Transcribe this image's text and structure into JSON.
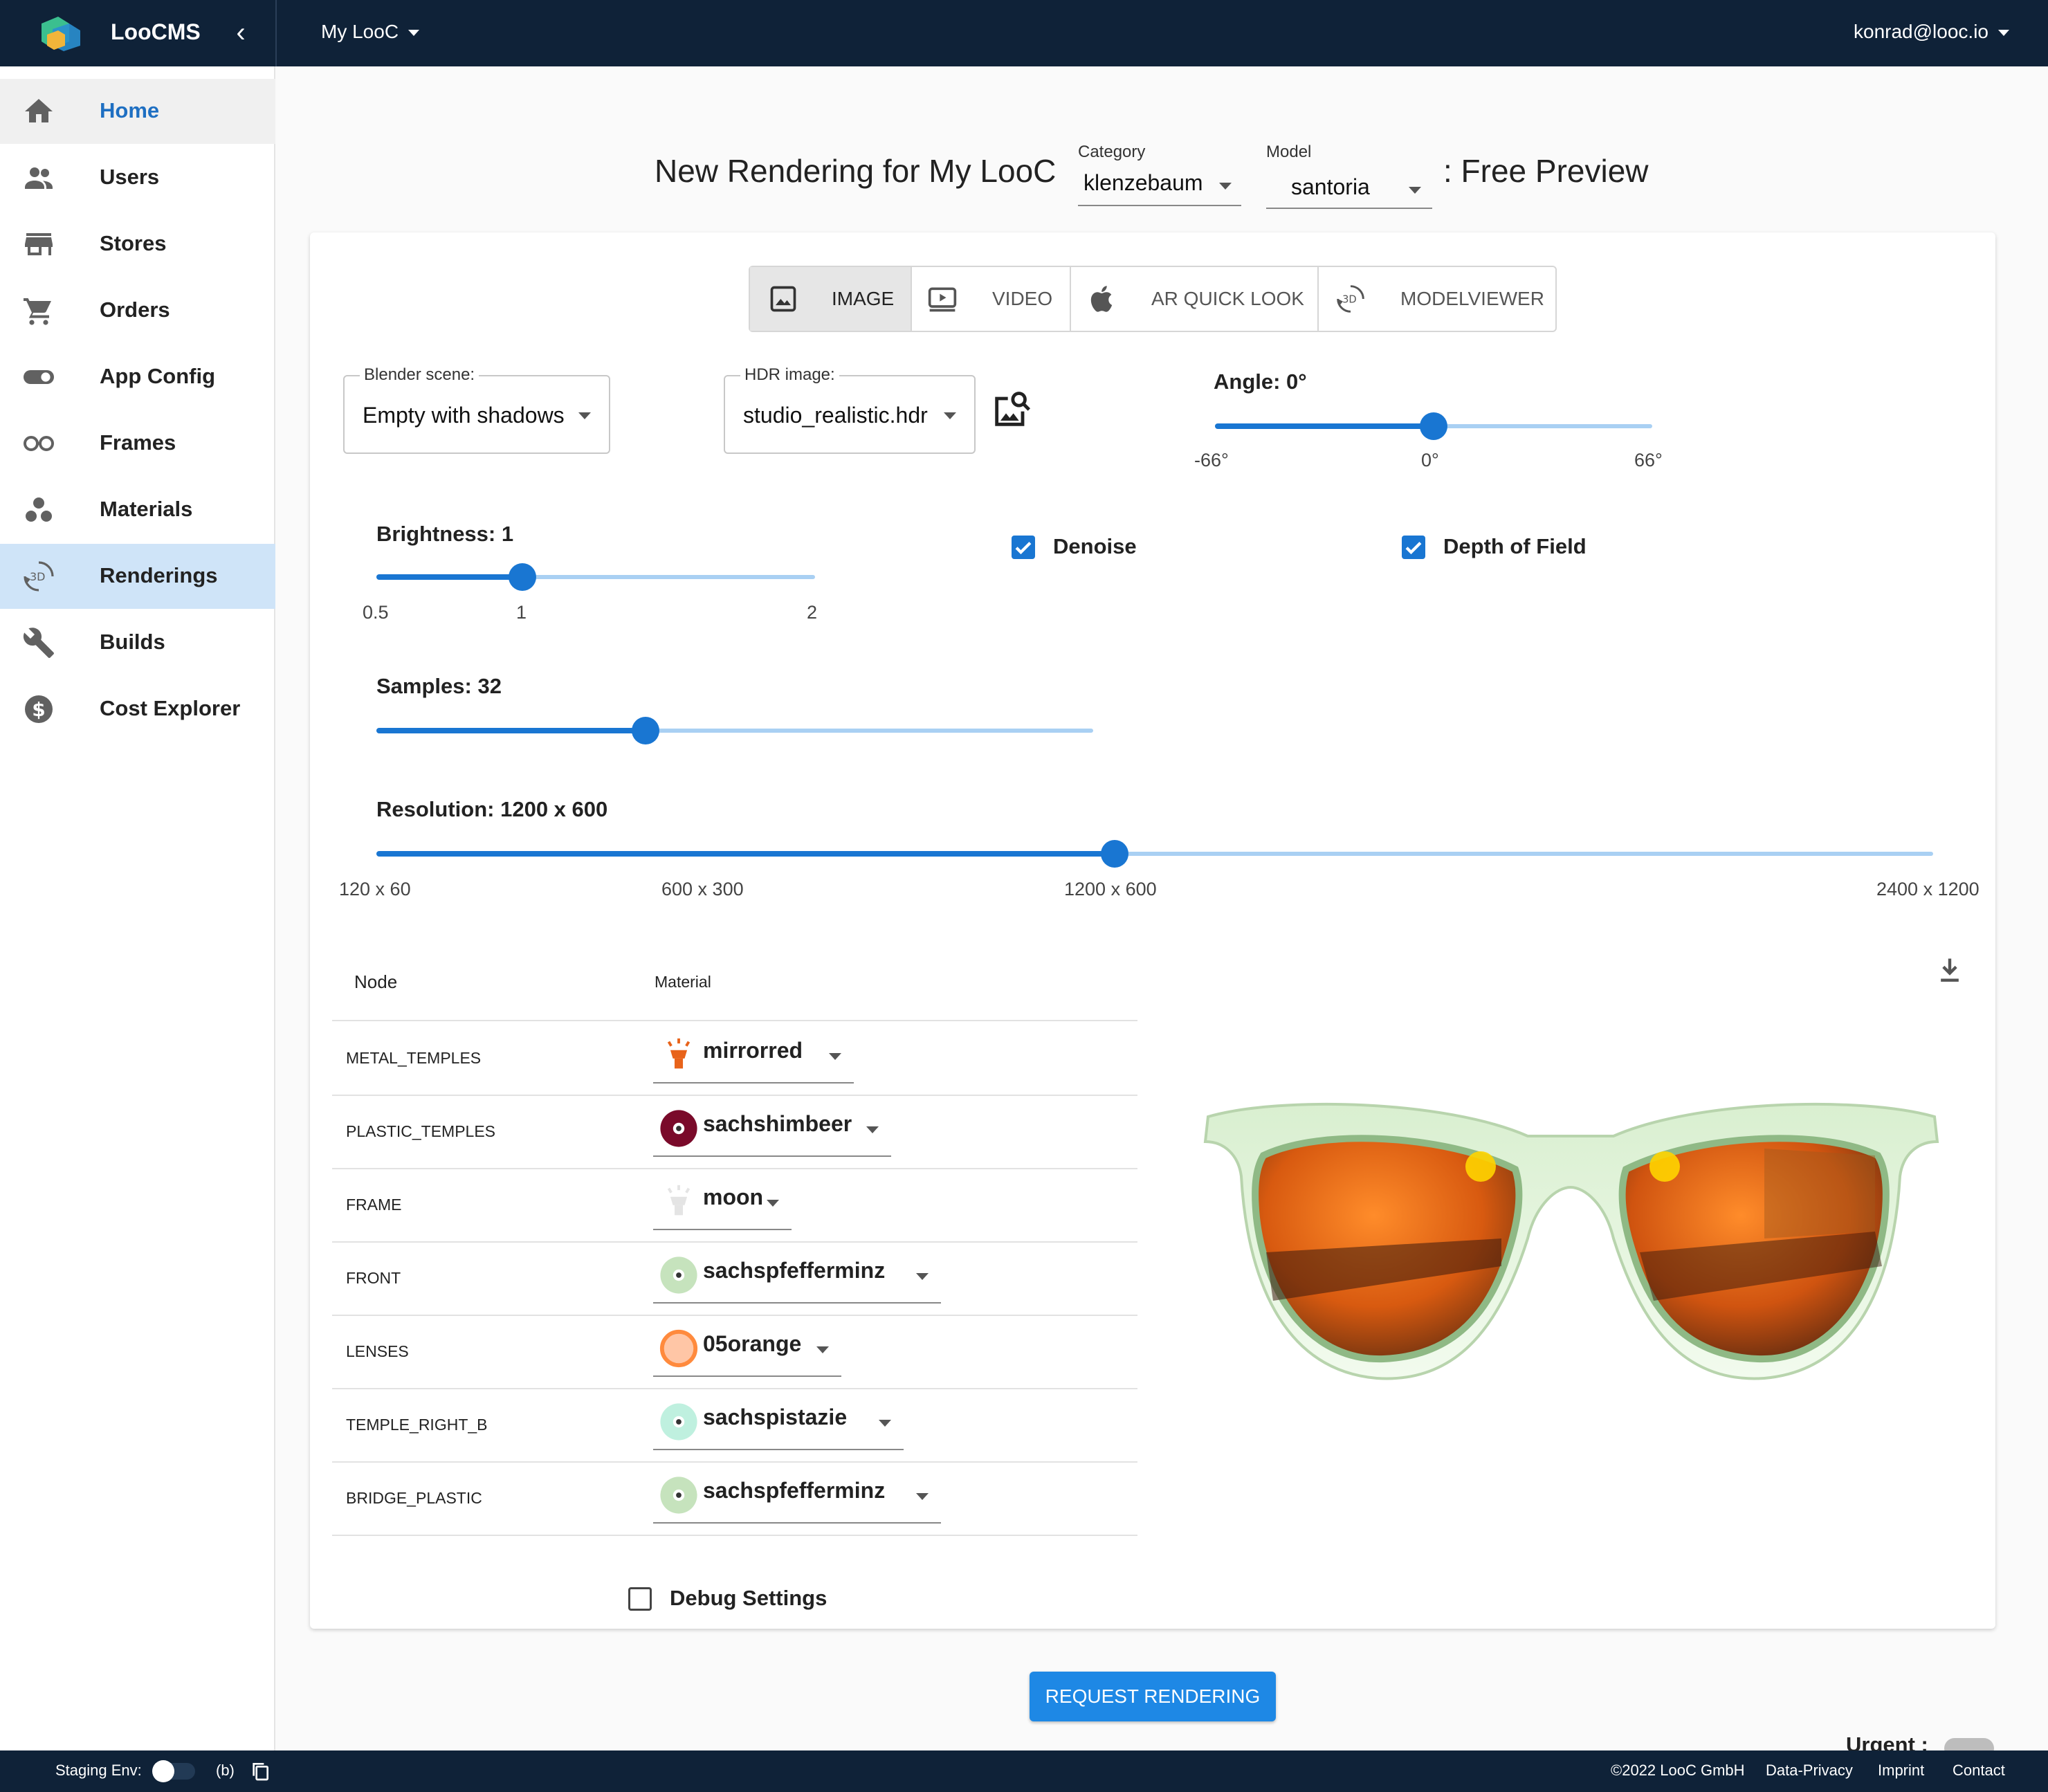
{
  "app": {
    "name": "LooCMS",
    "org": "My LooC",
    "user": "konrad@looc.io"
  },
  "sidebar": {
    "items": [
      {
        "label": "Home",
        "icon": "home-icon"
      },
      {
        "label": "Users",
        "icon": "users-icon"
      },
      {
        "label": "Stores",
        "icon": "store-icon"
      },
      {
        "label": "Orders",
        "icon": "cart-icon"
      },
      {
        "label": "App Config",
        "icon": "toggle-icon"
      },
      {
        "label": "Frames",
        "icon": "glasses-icon"
      },
      {
        "label": "Materials",
        "icon": "materials-icon"
      },
      {
        "label": "Renderings",
        "icon": "3d-rotate-icon"
      },
      {
        "label": "Builds",
        "icon": "wrench-icon"
      },
      {
        "label": "Cost Explorer",
        "icon": "dollar-icon"
      }
    ],
    "active": "Renderings"
  },
  "heading": {
    "prefix": "New Rendering for My LooC",
    "category_label": "Category",
    "category_value": "klenzebaum",
    "model_label": "Model",
    "model_value": "santoria",
    "suffix": ": Free Preview"
  },
  "tabs": [
    {
      "label": "IMAGE",
      "icon": "image-icon",
      "selected": true
    },
    {
      "label": "VIDEO",
      "icon": "video-icon",
      "selected": false
    },
    {
      "label": "AR QUICK LOOK",
      "icon": "apple-icon",
      "selected": false
    },
    {
      "label": "MODELVIEWER",
      "icon": "3d-rotate-icon",
      "selected": false
    }
  ],
  "settings": {
    "blender_scene_label": "Blender scene:",
    "blender_scene_value": "Empty with shadows",
    "hdr_label": "HDR image:",
    "hdr_value": "studio_realistic.hdr",
    "angle": {
      "title": "Angle: 0°",
      "min_label": "-66°",
      "mid_label": "0°",
      "max_label": "66°",
      "min": -66,
      "max": 66,
      "value": 0
    },
    "brightness": {
      "title": "Brightness: 1",
      "min_label": "0.5",
      "mid_label": "1",
      "max_label": "2",
      "min": 0.5,
      "max": 2,
      "value": 1
    },
    "samples": {
      "title": "Samples: 32",
      "value": 32,
      "fraction": 0.375
    },
    "resolution": {
      "title": "Resolution: 1200 x 600",
      "ticks": [
        "120 x 60",
        "600 x 300",
        "1200 x 600",
        "2400 x 1200"
      ],
      "value": "1200 x 600",
      "fraction": 0.474
    },
    "denoise": {
      "label": "Denoise",
      "checked": true
    },
    "depth_of_field": {
      "label": "Depth of Field",
      "checked": true
    }
  },
  "table": {
    "headers": {
      "node": "Node",
      "material": "Material"
    },
    "rows": [
      {
        "node": "METAL_TEMPLES",
        "material": "mirrorred",
        "swatch": "lamp-icon",
        "color": "#e8631a"
      },
      {
        "node": "PLASTIC_TEMPLES",
        "material": "sachshimbeer",
        "swatch": "disc-icon",
        "color": "#7a0a2a"
      },
      {
        "node": "FRAME",
        "material": "moon",
        "swatch": "lamp-icon",
        "color": "#e4e4e4"
      },
      {
        "node": "FRONT",
        "material": "sachspfefferminz",
        "swatch": "disc-icon",
        "color": "#c6e3bd"
      },
      {
        "node": "LENSES",
        "material": "05orange",
        "swatch": "circle-icon",
        "color": "#ff8a3d"
      },
      {
        "node": "TEMPLE_RIGHT_B",
        "material": "sachspistazie",
        "swatch": "disc-icon",
        "color": "#bff0df"
      },
      {
        "node": "BRIDGE_PLASTIC",
        "material": "sachspfefferminz",
        "swatch": "disc-icon",
        "color": "#c6e3bd"
      }
    ]
  },
  "debug_label": "Debug Settings",
  "request_button": "REQUEST RENDERING",
  "urgent_label": "Urgent :",
  "footer": {
    "env_label": "Staging Env:",
    "branch": "(b)",
    "copyright": "©2022 LooC GmbH",
    "links": [
      "Data-Privacy",
      "Imprint",
      "Contact"
    ]
  },
  "colors": {
    "primary": "#1976d2",
    "appbar": "#0f2238",
    "active_nav": "#cfe4f8"
  }
}
